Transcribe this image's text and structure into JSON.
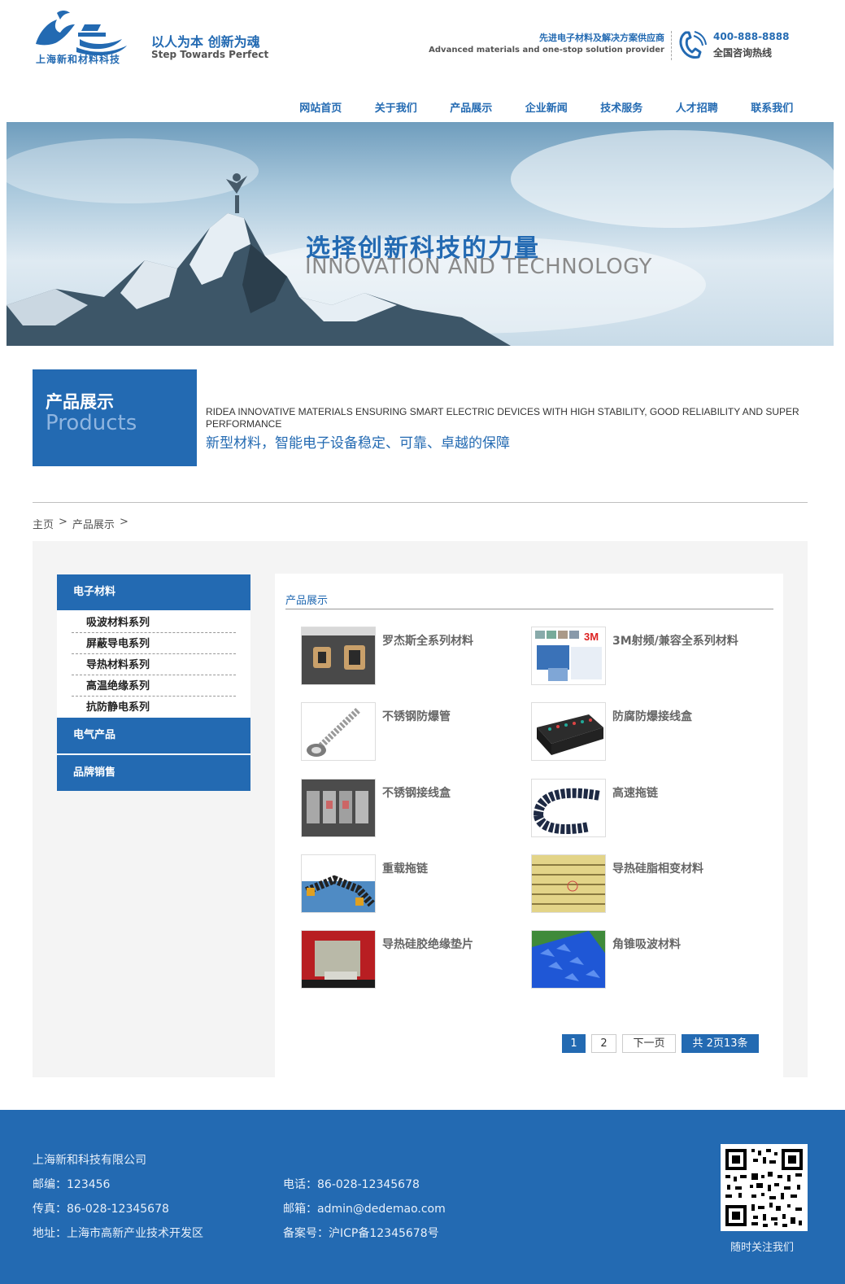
{
  "header": {
    "logo_text": "上海新和材料科技",
    "slogan_cn": "以人为本 创新为魂",
    "slogan_en": "Step Towards Perfect",
    "tagline_cn": "先进电子材料及解决方案供应商",
    "tagline_en": "Advanced materials and one-stop solution provider",
    "hotline_number": "400-888-8888",
    "hotline_label": "全国咨询热线"
  },
  "nav": [
    "网站首页",
    "关于我们",
    "产品展示",
    "企业新闻",
    "技术服务",
    "人才招聘",
    "联系我们"
  ],
  "banner": {
    "title_cn": "选择创新科技的力量",
    "title_en": "INNOVATION AND TECHNOLOGY"
  },
  "section": {
    "title_cn": "产品展示",
    "title_en": "Products",
    "desc_en": "RIDEA INNOVATIVE MATERIALS ENSURING SMART ELECTRIC DEVICES WITH HIGH STABILITY, GOOD RELIABILITY AND SUPER PERFORMANCE",
    "desc_cn": "新型材料，智能电子设备稳定、可靠、卓越的保障"
  },
  "breadcrumb": {
    "home": "主页",
    "sep": ">",
    "current": "产品展示"
  },
  "sidebar": {
    "cat1": "电子材料",
    "sub": [
      "吸波材料系列",
      "屏蔽导电系列",
      "导热材料系列",
      "高温绝缘系列",
      "抗防静电系列"
    ],
    "cat2": "电气产品",
    "cat3": "品牌销售"
  },
  "content": {
    "title": "产品展示",
    "products": [
      "罗杰斯全系列材料",
      "3M射频/兼容全系列材料",
      "不锈钢防爆管",
      "防腐防爆接线盒",
      "不锈钢接线盒",
      "高速拖链",
      "重载拖链",
      "导热硅脂相变材料",
      "导热硅胶绝缘垫片",
      "角锥吸波材料"
    ]
  },
  "pager": {
    "page1": "1",
    "page2": "2",
    "next": "下一页",
    "info": "共 2页13条"
  },
  "footer": {
    "company": "上海新和科技有限公司",
    "postcode": "邮编：123456",
    "phone": "电话：86-028-12345678",
    "fax": "传真：86-028-12345678",
    "email": "邮箱：admin@dedemao.com",
    "address": "地址：上海市高新产业技术开发区",
    "icp": "备案号：沪ICP备12345678号",
    "qr_label": "随时关注我们"
  },
  "colors": {
    "brand": "#236ab2",
    "main_bg": "#f4f4f4"
  }
}
